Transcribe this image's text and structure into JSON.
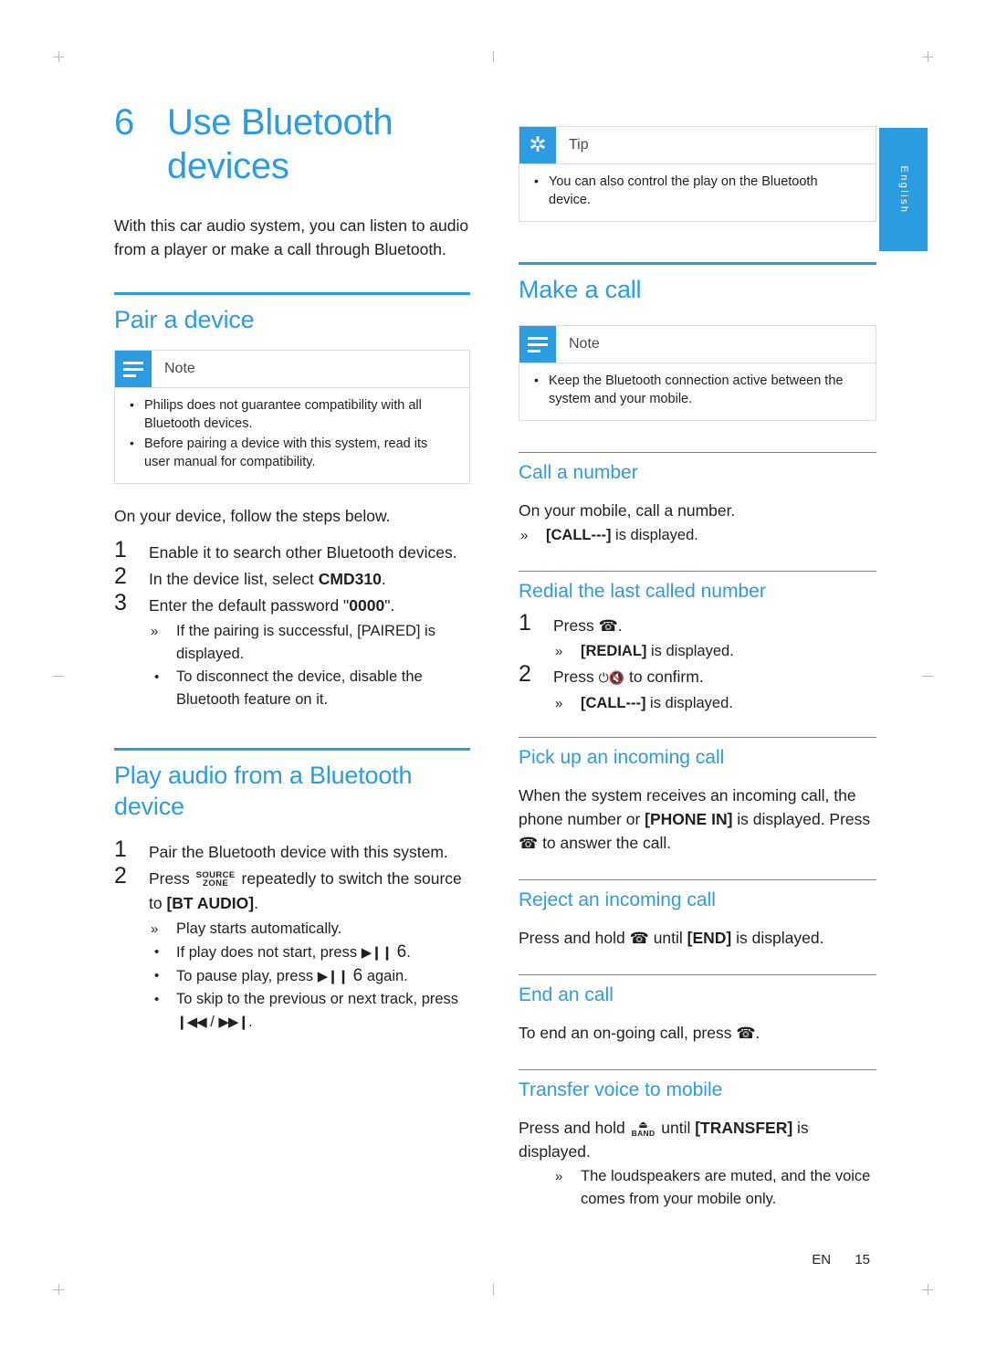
{
  "page": {
    "language_tab": "English",
    "footer_lang": "EN",
    "footer_page": "15"
  },
  "chapter": {
    "number": "6",
    "title": "Use Bluetooth devices",
    "intro": "With this car audio system, you can listen to audio from a player or make a call through Bluetooth."
  },
  "left": {
    "pair": {
      "heading": "Pair a device",
      "note_title": "Note",
      "note_items": [
        "Philips does not guarantee compatibility with all Bluetooth devices.",
        "Before pairing a device with this system, read its user manual for compatibility."
      ],
      "lead": "On your device, follow the steps below.",
      "steps": [
        {
          "n": "1",
          "text": "Enable it to search other Bluetooth devices."
        },
        {
          "n": "2",
          "text_pre": "In the device list, select ",
          "bold": "CMD310",
          "text_post": "."
        },
        {
          "n": "3",
          "text_pre": "Enter the default password \"",
          "bold": "0000",
          "text_post": "\"."
        }
      ],
      "sub_arrow": "If the pairing is successful, [PAIRED] is displayed.",
      "sub_dot": "To disconnect the device, disable the Bluetooth feature on it."
    },
    "play": {
      "heading": "Play audio from a Bluetooth device",
      "step1": "Pair the Bluetooth device with this system.",
      "step2_pre": "Press",
      "step2_btn_top": "SOURCE",
      "step2_btn_bottom": "ZONE",
      "step2_mid": "repeatedly to switch the source to ",
      "step2_bracket": "[BT AUDIO]",
      "step2_end": ".",
      "arrow1": "Play starts automatically.",
      "dot1_pre": "If play does not start, press ",
      "dot1_post": ".",
      "dot2_pre": "To pause play, press ",
      "dot2_post": " again.",
      "dot3": "To skip to the previous or next track, press",
      "dot3_sep": "/"
    }
  },
  "right": {
    "tip": {
      "title": "Tip",
      "items": [
        "You can also control the play on the Bluetooth device."
      ]
    },
    "make_call": {
      "heading": "Make a call",
      "note_title": "Note",
      "note_items": [
        "Keep the Bluetooth connection active between the system and your mobile."
      ]
    },
    "call_number": {
      "heading": "Call a number",
      "line": "On your mobile, call a number.",
      "arrow": "[CALL---] is displayed."
    },
    "redial": {
      "heading": "Redial the last called number",
      "step1_pre": "Press",
      "step1_post": ".",
      "arrow1": "[REDIAL] is displayed.",
      "step2_pre": "Press",
      "step2_post": "to confirm.",
      "arrow2": "[CALL---] is displayed."
    },
    "pickup": {
      "heading": "Pick up an incoming call",
      "body_pre": "When the system receives an incoming call, the phone number or ",
      "body_bold": "[PHONE IN]",
      "body_post": " is displayed. Press",
      "body_end": "to answer the call."
    },
    "reject": {
      "heading": "Reject an incoming call",
      "body_pre": "Press and hold",
      "body_mid": "until ",
      "body_bold": "[END]",
      "body_post": " is displayed."
    },
    "end_call": {
      "heading": "End an call",
      "body_pre": "To end an on-going call, press",
      "body_post": "."
    },
    "transfer": {
      "heading": "Transfer voice to mobile",
      "body_pre": "Press and hold",
      "body_btn_bottom": "BAND",
      "body_mid": "until ",
      "body_bold": "[TRANSFER]",
      "body_post": " is displayed.",
      "arrow": "The loudspeakers are muted, and the voice comes from your mobile only."
    }
  },
  "colors": {
    "accent": "#2b9ce0",
    "text": "#231f20",
    "rule": "#dcdcdc"
  }
}
